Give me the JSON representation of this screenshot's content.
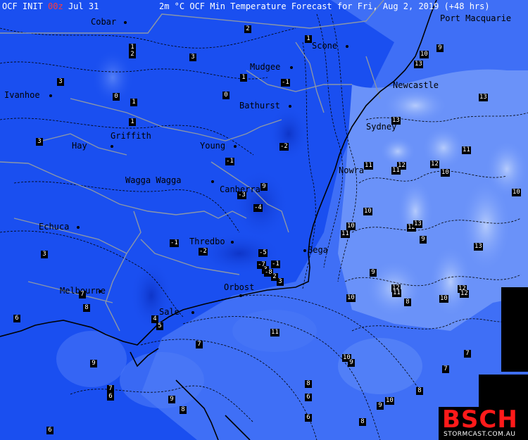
{
  "header": {
    "model": "OCF INIT ",
    "run": "00z",
    "date": " Jul 31",
    "title": "2m °C OCF Min Temperature Forecast for Fri, Aug 2, 2019 (+48 hrs)"
  },
  "places": [
    {
      "name": "Cobar"
    },
    {
      "name": "Scone"
    },
    {
      "name": "Port Macquarie"
    },
    {
      "name": "Mudgee"
    },
    {
      "name": "Ivanhoe"
    },
    {
      "name": "Newcastle"
    },
    {
      "name": "Bathurst"
    },
    {
      "name": "Griffith"
    },
    {
      "name": "Sydney"
    },
    {
      "name": "Hay"
    },
    {
      "name": "Young"
    },
    {
      "name": "Nowra"
    },
    {
      "name": "Wagga Wagga"
    },
    {
      "name": "Canberra"
    },
    {
      "name": "Echuca"
    },
    {
      "name": "Thredbo"
    },
    {
      "name": "Bega"
    },
    {
      "name": "Orbost"
    },
    {
      "name": "Melbourne"
    },
    {
      "name": "Sale"
    }
  ],
  "values": [
    "2",
    "1",
    "3",
    "2",
    "1",
    "10",
    "9",
    "13",
    "1",
    "3",
    "0",
    "-1",
    "1",
    "0",
    "13",
    "1",
    "13",
    "3",
    "-2",
    "11",
    "-1",
    "11",
    "12",
    "12",
    "10",
    "11",
    "-3",
    "9",
    "10",
    "-4",
    "10",
    "12",
    "13",
    "10",
    "11",
    "13",
    "9",
    "-1",
    "-2",
    "-5",
    "-7",
    "3",
    "-1",
    "-8",
    "9",
    "12",
    "2",
    "3",
    "7",
    "12",
    "11",
    "10",
    "12",
    "8",
    "10",
    "8",
    "4",
    "5",
    "6",
    "7",
    "11",
    "3",
    "7",
    "9",
    "10",
    "9",
    "8",
    "7",
    "7",
    "6",
    "9",
    "6",
    "8",
    "8",
    "9",
    "10",
    "6",
    "8",
    "6"
  ],
  "logo": {
    "text": "BSCH",
    "site": "STORMCAST.COM.AU"
  },
  "colors": {
    "deep": "#1a4ff0",
    "mid": "#3d6cf5",
    "light": "#8fb0fb",
    "pale": "#b5cbfc"
  }
}
